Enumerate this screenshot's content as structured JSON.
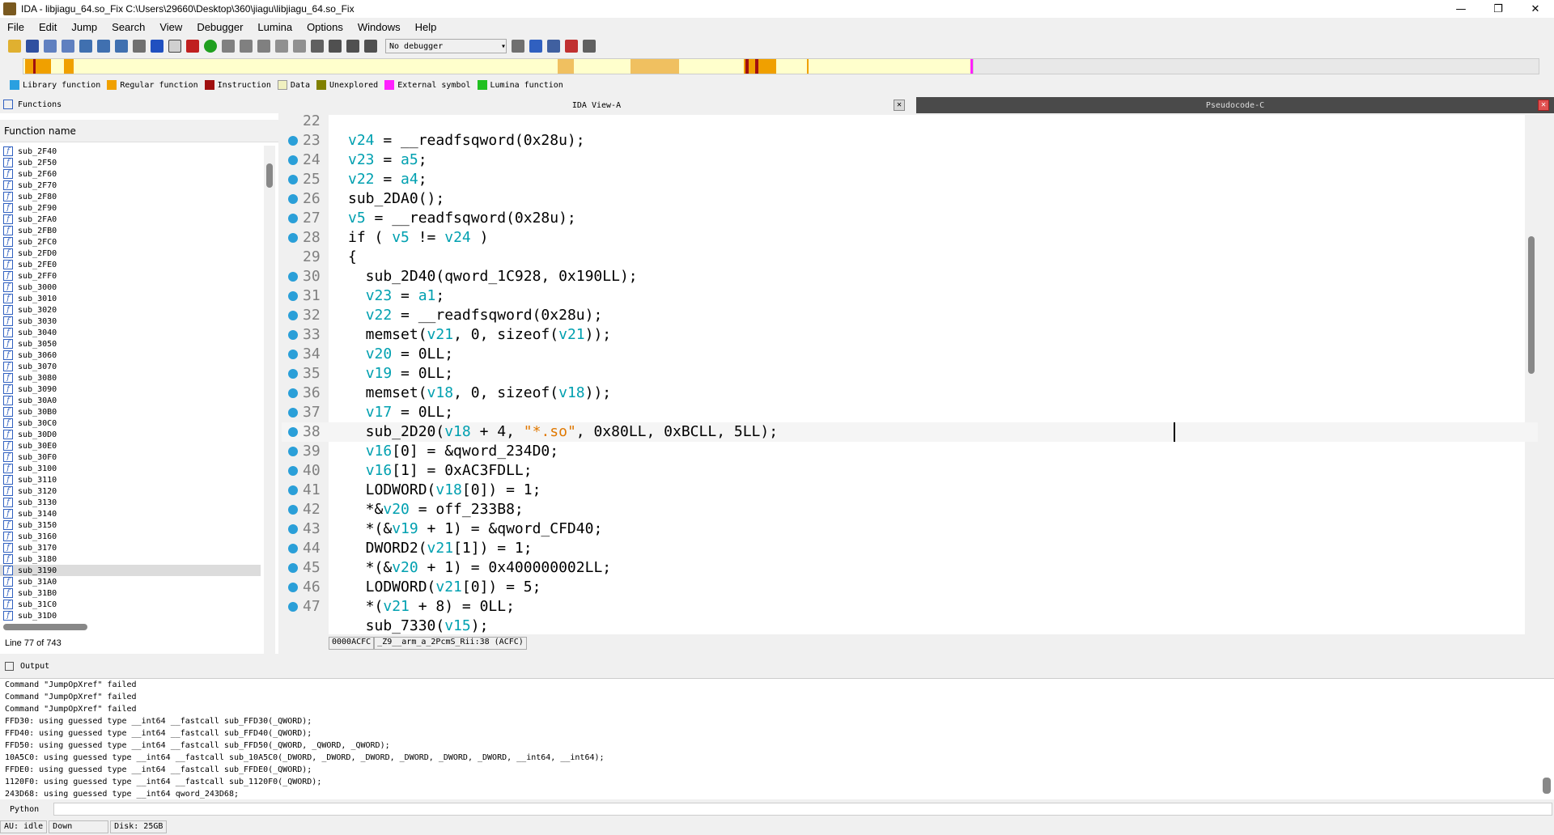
{
  "window": {
    "title": "IDA - libjiagu_64.so_Fix C:\\Users\\29660\\Desktop\\360\\jiagu\\libjiagu_64.so_Fix",
    "minimize": "—",
    "maximize": "❐",
    "close": "✕"
  },
  "menu": [
    "File",
    "Edit",
    "Jump",
    "Search",
    "View",
    "Debugger",
    "Lumina",
    "Options",
    "Windows",
    "Help"
  ],
  "toolbar": {
    "debugger_select": "No debugger"
  },
  "legend": [
    {
      "label": "Library function",
      "color": "#2aa0e0"
    },
    {
      "label": "Regular function",
      "color": "#f0a000"
    },
    {
      "label": "Instruction",
      "color": "#a01010"
    },
    {
      "label": "Data",
      "color": "#f0f0c0"
    },
    {
      "label": "Unexplored",
      "color": "#808000"
    },
    {
      "label": "External symbol",
      "color": "#ff20ff"
    },
    {
      "label": "Lumina function",
      "color": "#20c020"
    }
  ],
  "functions": {
    "title": "Functions",
    "column": "Function name",
    "items": [
      "sub_2F40",
      "sub_2F50",
      "sub_2F60",
      "sub_2F70",
      "sub_2F80",
      "sub_2F90",
      "sub_2FA0",
      "sub_2FB0",
      "sub_2FC0",
      "sub_2FD0",
      "sub_2FE0",
      "sub_2FF0",
      "sub_3000",
      "sub_3010",
      "sub_3020",
      "sub_3030",
      "sub_3040",
      "sub_3050",
      "sub_3060",
      "sub_3070",
      "sub_3080",
      "sub_3090",
      "sub_30A0",
      "sub_30B0",
      "sub_30C0",
      "sub_30D0",
      "sub_30E0",
      "sub_30F0",
      "sub_3100",
      "sub_3110",
      "sub_3120",
      "sub_3130",
      "sub_3140",
      "sub_3150",
      "sub_3160",
      "sub_3170",
      "sub_3180",
      "sub_3190",
      "sub_31A0",
      "sub_31B0",
      "sub_31C0",
      "sub_31D0"
    ],
    "selected": "sub_3190",
    "line_count": "Line 77 of 743"
  },
  "tabs": {
    "ida_view": "IDA View-A",
    "pseudocode": "Pseudocode-C"
  },
  "code": {
    "lines": [
      {
        "num": "22",
        "html": ""
      },
      {
        "num": "23",
        "html": "<span class='v'>v24</span> = __readfsqword(0x28u);"
      },
      {
        "num": "24",
        "html": "<span class='v'>v23</span> = <span class='v'>a5</span>;"
      },
      {
        "num": "25",
        "html": "<span class='v'>v22</span> = <span class='v'>a4</span>;"
      },
      {
        "num": "26",
        "html": "sub_2DA0();"
      },
      {
        "num": "27",
        "html": "<span class='v'>v5</span> = __readfsqword(0x28u);"
      },
      {
        "num": "28",
        "html": "if ( <span class='v'>v5</span> != <span class='v'>v24</span> )"
      },
      {
        "num": "29",
        "html": "{"
      },
      {
        "num": "30",
        "html": "  sub_2D40(qword_1C928, 0x190LL);"
      },
      {
        "num": "31",
        "html": "  <span class='v'>v23</span> = <span class='v'>a1</span>;"
      },
      {
        "num": "32",
        "html": "  <span class='v'>v22</span> = __readfsqword(0x28u);"
      },
      {
        "num": "33",
        "html": "  memset(<span class='v'>v21</span>, 0, sizeof(<span class='v'>v21</span>));"
      },
      {
        "num": "34",
        "html": "  <span class='v'>v20</span> = 0LL;"
      },
      {
        "num": "35",
        "html": "  <span class='v'>v19</span> = 0LL;"
      },
      {
        "num": "36",
        "html": "  memset(<span class='v'>v18</span>, 0, sizeof(<span class='v'>v18</span>));"
      },
      {
        "num": "37",
        "html": "  <span class='v'>v17</span> = 0LL;"
      },
      {
        "num": "38",
        "html": "  sub_2D20(<span class='v'>v18</span> + 4, <span class='s'>\"*.so\"</span>, 0x80LL, 0xBCLL, 5LL);"
      },
      {
        "num": "39",
        "html": "  <span class='v'>v16</span>[0] = &amp;qword_234D0;"
      },
      {
        "num": "40",
        "html": "  <span class='v'>v16</span>[1] = 0xAC3FDLL;"
      },
      {
        "num": "41",
        "html": "  LODWORD(<span class='v'>v18</span>[0]) = 1;"
      },
      {
        "num": "42",
        "html": "  *&amp;<span class='v'>v20</span> = off_233B8;"
      },
      {
        "num": "43",
        "html": "  *(&amp;<span class='v'>v19</span> + 1) = &amp;qword_CFD40;"
      },
      {
        "num": "44",
        "html": "  DWORD2(<span class='v'>v21</span>[1]) = 1;"
      },
      {
        "num": "45",
        "html": "  *(&amp;<span class='v'>v20</span> + 1) = 0x400000002LL;"
      },
      {
        "num": "46",
        "html": "  LODWORD(<span class='v'>v21</span>[0]) = 5;"
      },
      {
        "num": "47",
        "html": "  *(<span class='v'>v21</span> + 8) = 0LL;"
      },
      {
        "num": "",
        "html": "  sub_7330(<span class='v'>v15</span>);"
      }
    ],
    "current_line": "38"
  },
  "status_line": {
    "address": "0000ACFC",
    "location": "_Z9__arm_a_2PcmS_Rii:38 (ACFC)"
  },
  "output": {
    "title": "Output",
    "lines": [
      "Command \"JumpOpXref\" failed",
      "Command \"JumpOpXref\" failed",
      "Command \"JumpOpXref\" failed",
      "FFD30: using guessed type __int64 __fastcall sub_FFD30(_QWORD);",
      "FFD40: using guessed type __int64 __fastcall sub_FFD40(_QWORD);",
      "FFD50: using guessed type __int64 __fastcall sub_FFD50(_QWORD, _QWORD, _QWORD);",
      "10A5C0: using guessed type __int64 __fastcall sub_10A5C0(_DWORD, _DWORD, _DWORD, _DWORD, _DWORD, _DWORD, __int64, __int64);",
      "FFDE0: using guessed type __int64 __fastcall sub_FFDE0(_QWORD);",
      "1120F0: using guessed type __int64 __fastcall sub_1120F0(_QWORD);",
      "243D68: using guessed type __int64 qword_243D68;"
    ]
  },
  "python_label": "Python",
  "statusbar": {
    "au": "AU:  idle",
    "dir": "Down",
    "disk": "Disk: 25GB"
  }
}
